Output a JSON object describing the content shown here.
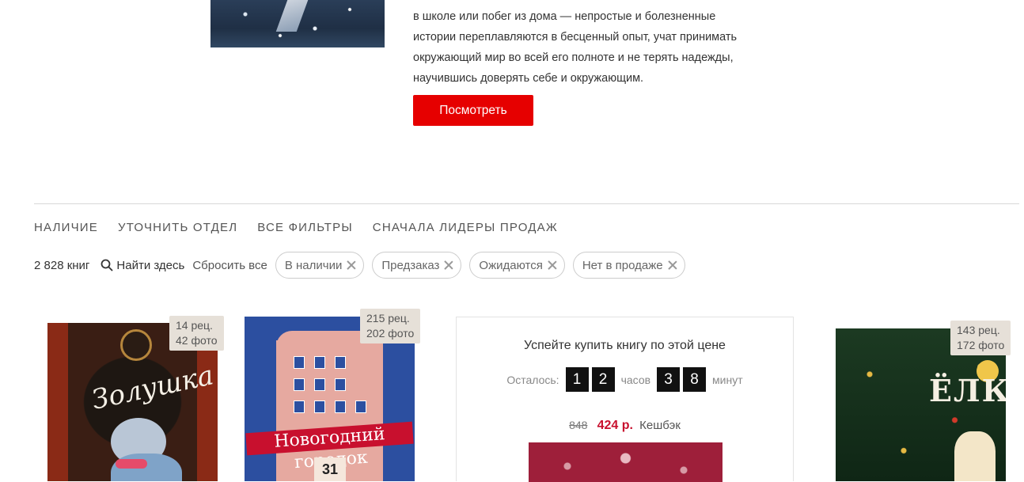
{
  "promo": {
    "lines": [
      "в школе или побег из дома — непростые и болезненные",
      "истории переплавляются в бесценный опыт, учат принимать",
      "окружающий мир во всей его полноте и не терять надежды,",
      "научившись доверять себе и окружающим."
    ],
    "button_label": "Посмотреть"
  },
  "filters": {
    "items": [
      "Наличие",
      "Уточнить отдел",
      "Все фильтры",
      "Сначала лидеры продаж"
    ]
  },
  "results": {
    "count": "2 828 книг",
    "search_label": "Найти здесь",
    "reset_label": "Сбросить все",
    "chips": [
      "В наличии",
      "Предзаказ",
      "Ожидаются",
      "Нет в продаже"
    ]
  },
  "books": [
    {
      "reviews": "14 рец.",
      "photos": "42 фото",
      "cover_title": "Золушка"
    },
    {
      "reviews": "215 рец.",
      "photos": "202 фото",
      "cover_title": "Новогодний городок",
      "cover_number": "31"
    },
    {
      "reviews": "143 рец.",
      "photos": "172 фото",
      "cover_title": "ЁЛКА"
    }
  ],
  "deal": {
    "title": "Успейте купить книгу по этой цене",
    "remaining_label": "Осталось:",
    "hours_digits": [
      "1",
      "2"
    ],
    "hours_label": "часов",
    "minutes_digits": [
      "3",
      "8"
    ],
    "minutes_label": "минут",
    "old_price": "848",
    "new_price": "424 р.",
    "cashback_label": "Кешбэк"
  },
  "colors": {
    "accent_red": "#e60000",
    "price_red": "#c8102e"
  }
}
